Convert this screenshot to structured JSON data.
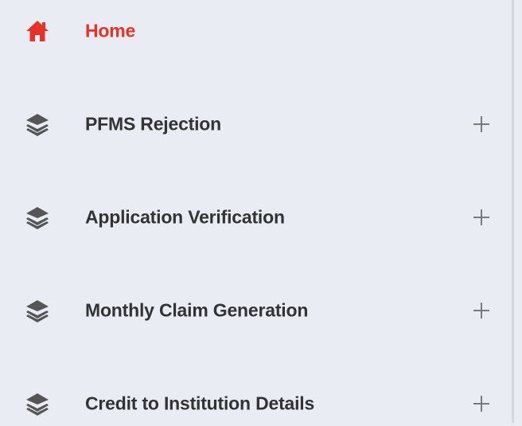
{
  "sidebar": {
    "items": [
      {
        "label": "Home",
        "icon": "home-icon",
        "active": true,
        "color": "#e5332a"
      },
      {
        "label": "PFMS Rejection",
        "icon": "layers-icon",
        "expandable": true
      },
      {
        "label": "Application Verification",
        "icon": "layers-icon",
        "expandable": true
      },
      {
        "label": "Monthly Claim Generation",
        "icon": "layers-icon",
        "expandable": true
      },
      {
        "label": "Credit to Institution Details",
        "icon": "layers-icon",
        "expandable": true
      }
    ]
  }
}
